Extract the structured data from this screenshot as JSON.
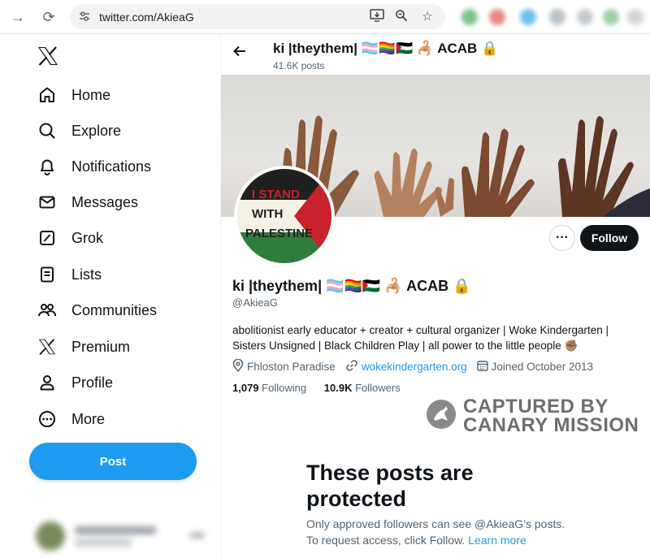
{
  "browser": {
    "url": "twitter.com/AkieaG",
    "back_icon": "→",
    "reload_icon": "⟳"
  },
  "sidebar": {
    "logo": "𝕏",
    "items": [
      {
        "label": "Home",
        "icon": "home-icon"
      },
      {
        "label": "Explore",
        "icon": "search-icon"
      },
      {
        "label": "Notifications",
        "icon": "bell-icon"
      },
      {
        "label": "Messages",
        "icon": "envelope-icon"
      },
      {
        "label": "Grok",
        "icon": "grok-icon"
      },
      {
        "label": "Lists",
        "icon": "list-icon"
      },
      {
        "label": "Communities",
        "icon": "people-icon"
      },
      {
        "label": "Premium",
        "icon": "x-icon"
      },
      {
        "label": "Profile",
        "icon": "person-icon"
      },
      {
        "label": "More",
        "icon": "more-circle-icon"
      }
    ],
    "post_label": "Post"
  },
  "header": {
    "name": "ki |theythem| 🏳️‍⚧️🏳️‍🌈🇵🇸 🦂 ACAB 🔒",
    "posts_count": "41.6K posts"
  },
  "avatar_text": {
    "line1": "I STAND",
    "line2": "WITH",
    "line3": "PALESTINE"
  },
  "profile": {
    "display_name": "ki |theythem| 🏳️‍⚧️🏳️‍🌈🇵🇸 🦂 ACAB 🔒",
    "handle": "@AkieaG",
    "bio": "abolitionist early educator + creator + cultural organizer | Woke Kindergarten | Sisters Unsigned | Black Children Play | all power to the little people ✊🏽",
    "location": "Fhloston Paradise",
    "website": "wokekindergarten.org",
    "joined": "Joined October 2013",
    "following_count": "1,079",
    "following_label": "Following",
    "followers_count": "10.9K",
    "followers_label": "Followers",
    "follow_label": "Follow",
    "more_label": "···"
  },
  "watermark": {
    "line1": "CAPTURED BY",
    "line2": "CANARY MISSION"
  },
  "protected": {
    "title": "These posts are protected",
    "subtitle": "Only approved followers can see @AkieaG’s posts.",
    "subtitle2_prefix": "To request access, click Follow. ",
    "learn_more": "Learn more"
  },
  "colors": {
    "accent": "#1d9bf0",
    "text_primary": "#0f1419",
    "text_secondary": "#536471"
  }
}
